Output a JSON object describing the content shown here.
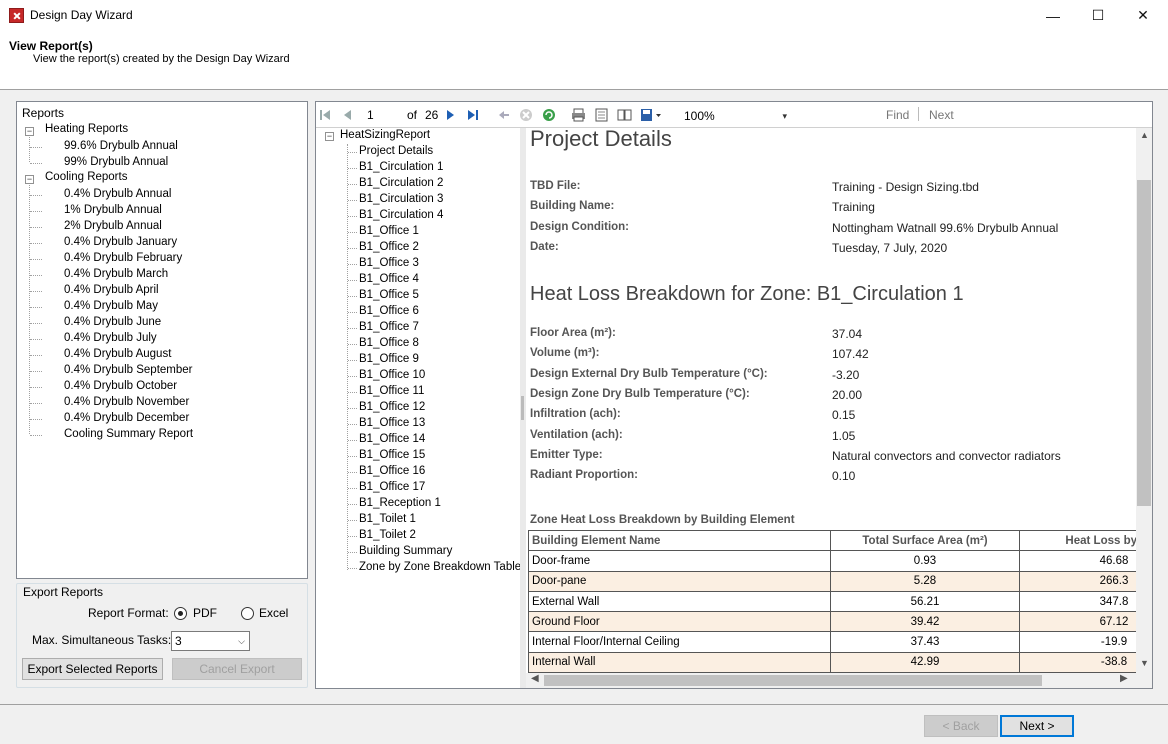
{
  "window": {
    "title": "Design Day Wizard",
    "minimize": "—",
    "maximize": "☐",
    "close": "✕"
  },
  "header": {
    "title": "View Report(s)",
    "subtitle": "View the report(s) created by the Design Day Wizard"
  },
  "reports_tree": {
    "root_label": "Reports",
    "heating": {
      "label": "Heating Reports",
      "items": [
        "99.6% Drybulb Annual",
        "99% Drybulb Annual"
      ]
    },
    "cooling": {
      "label": "Cooling Reports",
      "items": [
        "0.4% Drybulb Annual",
        "1% Drybulb Annual",
        "2% Drybulb Annual",
        "0.4% Drybulb January",
        "0.4% Drybulb February",
        "0.4% Drybulb March",
        "0.4% Drybulb April",
        "0.4% Drybulb May",
        "0.4% Drybulb June",
        "0.4% Drybulb July",
        "0.4% Drybulb August",
        "0.4% Drybulb September",
        "0.4% Drybulb October",
        "0.4% Drybulb November",
        "0.4% Drybulb December",
        "Cooling Summary Report"
      ]
    }
  },
  "export": {
    "legend": "Export Reports",
    "format_label": "Report Format:",
    "pdf_label": "PDF",
    "excel_label": "Excel",
    "selected_format": "PDF",
    "tasks_label": "Max. Simultaneous Tasks:",
    "tasks_value": "3",
    "export_button": "Export Selected Reports",
    "cancel_button": "Cancel Export"
  },
  "toolbar": {
    "page": "1",
    "of_label": "of",
    "total_pages": "26",
    "zoom": "100%",
    "find": "Find",
    "next": "Next"
  },
  "doc_map": {
    "root": "HeatSizingReport",
    "items": [
      "Project Details",
      "B1_Circulation 1",
      "B1_Circulation 2",
      "B1_Circulation 3",
      "B1_Circulation 4",
      "B1_Office 1",
      "B1_Office 2",
      "B1_Office 3",
      "B1_Office 4",
      "B1_Office 5",
      "B1_Office 6",
      "B1_Office 7",
      "B1_Office 8",
      "B1_Office 9",
      "B1_Office 10",
      "B1_Office 11",
      "B1_Office 12",
      "B1_Office 13",
      "B1_Office 14",
      "B1_Office 15",
      "B1_Office 16",
      "B1_Office 17",
      "B1_Reception 1",
      "B1_Toilet 1",
      "B1_Toilet 2",
      "Building Summary",
      "Zone by Zone Breakdown Table"
    ]
  },
  "report": {
    "project_heading": "Project Details",
    "project_fields": [
      {
        "label": "TBD File:",
        "value": "Training - Design Sizing.tbd"
      },
      {
        "label": "Building Name:",
        "value": "Training"
      },
      {
        "label": "Design Condition:",
        "value": "Nottingham Watnall 99.6% Drybulb Annual"
      },
      {
        "label": "Date:",
        "value": "Tuesday, 7 July, 2020"
      }
    ],
    "zone_heading": "Heat Loss Breakdown for Zone: B1_Circulation 1",
    "zone_fields": [
      {
        "label": "Floor Area (m²):",
        "value": "37.04"
      },
      {
        "label": "Volume (m³):",
        "value": "107.42"
      },
      {
        "label": "Design External Dry Bulb Temperature (°C):",
        "value": "-3.20"
      },
      {
        "label": "Design Zone Dry Bulb Temperature (°C):",
        "value": "20.00"
      },
      {
        "label": "Infiltration (ach):",
        "value": "0.15"
      },
      {
        "label": "Ventilation (ach):",
        "value": "1.05"
      },
      {
        "label": "Emitter Type:",
        "value": "Natural convectors and convector radiators"
      },
      {
        "label": "Radiant Proportion:",
        "value": "0.10"
      }
    ],
    "table_title": "Zone Heat Loss Breakdown by Building Element",
    "table_headers": [
      "Building Element Name",
      "Total Surface Area (m²)",
      "Heat Loss by Con"
    ],
    "table_rows": [
      [
        "Door-frame",
        "0.93",
        "46.68"
      ],
      [
        "Door-pane",
        "5.28",
        "266.3"
      ],
      [
        "External Wall",
        "56.21",
        "347.8"
      ],
      [
        "Ground Floor",
        "39.42",
        "67.12"
      ],
      [
        "Internal Floor/Internal Ceiling",
        "37.43",
        "-19.9"
      ],
      [
        "Internal Wall",
        "42.99",
        "-38.8"
      ]
    ]
  },
  "footer": {
    "back": "< Back",
    "next": "Next >"
  }
}
